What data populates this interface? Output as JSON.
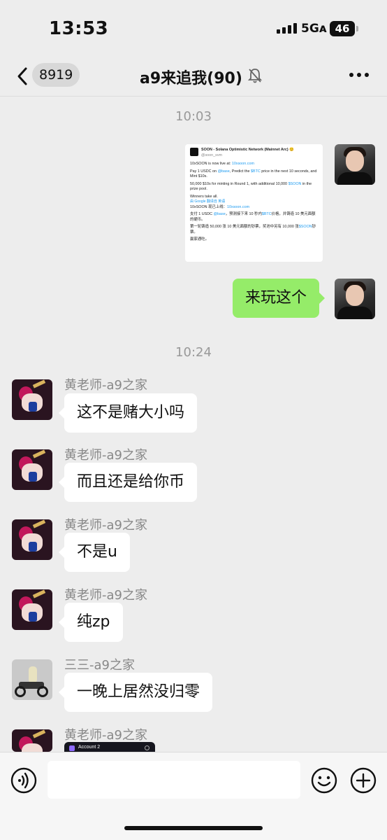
{
  "status_bar": {
    "time": "13:53",
    "network": "5Gᴀ",
    "battery": "46"
  },
  "nav": {
    "back_count": "8919",
    "title": "a9来追我(90)"
  },
  "messages": {
    "ts1": "10:03",
    "tweet": {
      "name": "SOON - Solana Optimistic Network (Mainnet Arc) 😊",
      "handle": "@soon_svm",
      "line1_pre": "10xSOON is now live at: ",
      "line1_link": "10xsoon.com",
      "line2_pre": "Pay 1 USDC on ",
      "line2_base": "@base",
      "line2_mid": ", Predict the ",
      "line2_btc": "$BTC",
      "line2_post": " price in the next 10 seconds, and Mint $10s.",
      "line3_pre": "50,000 $10s for minting in Round 1, with additional 10,000 ",
      "line3_soon": "$SOON",
      "line3_post": " in the prize pool.",
      "line4": "Winners take all.",
      "translate": "由 Google 翻译自 英语",
      "zh1_pre": "10xSOON 现已上线：",
      "zh1_link": "10xsoon.com",
      "zh2_pre": "支付 1 USDC ",
      "zh2_base": "@base",
      "zh2_mid": "，预测接下来 10 秒内",
      "zh2_btc": "$BTC",
      "zh2_post": "价格，并铸造 10 美元面额的硬币。",
      "zh3_pre": "第一轮铸造 50,000 张 10 美元面额的钞票，奖池中另有 10,000 张",
      "zh3_soon": "$SOON",
      "zh3_post": "钞票。",
      "zh4": "赢家通吃。"
    },
    "me_text": "来玩这个",
    "ts2": "10:24",
    "sender_huang": "黄老师-a9之家",
    "sender_san": "三三-a9之家",
    "msg1": "这不是赌大小吗",
    "msg2": "而且还是给你币",
    "msg3": "不是u",
    "msg4": "纯zp",
    "msg5": "一晚上居然没归零",
    "mini_img_label": "Account 2"
  },
  "input": {
    "value": ""
  },
  "colors": {
    "me_bubble": "#95ec69",
    "background": "#ededed"
  }
}
